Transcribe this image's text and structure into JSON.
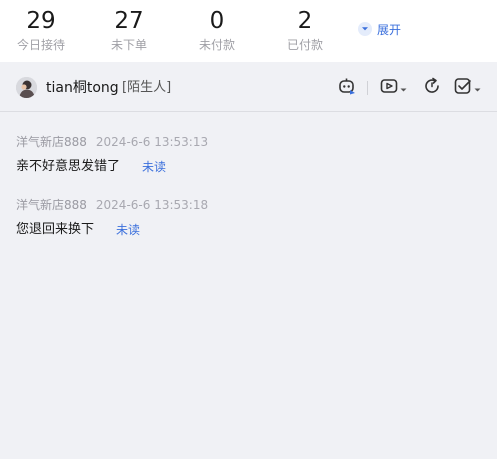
{
  "stats": [
    {
      "value": "29",
      "label": "今日接待"
    },
    {
      "value": "27",
      "label": "未下单"
    },
    {
      "value": "0",
      "label": "未付款"
    },
    {
      "value": "2",
      "label": "已付款"
    }
  ],
  "expand_label": "展开",
  "chat": {
    "user_name": "tian桐tong",
    "user_tag": "[陌生人]"
  },
  "messages": [
    {
      "sender": "洋气新店888",
      "time": "2024-6-6 13:53:13",
      "text": "亲不好意思发错了",
      "status": "未读"
    },
    {
      "sender": "洋气新店888",
      "time": "2024-6-6 13:53:18",
      "text": "您退回来换下",
      "status": "未读"
    }
  ],
  "colors": {
    "accent": "#3a6fdc",
    "background": "#f0f1f5"
  }
}
